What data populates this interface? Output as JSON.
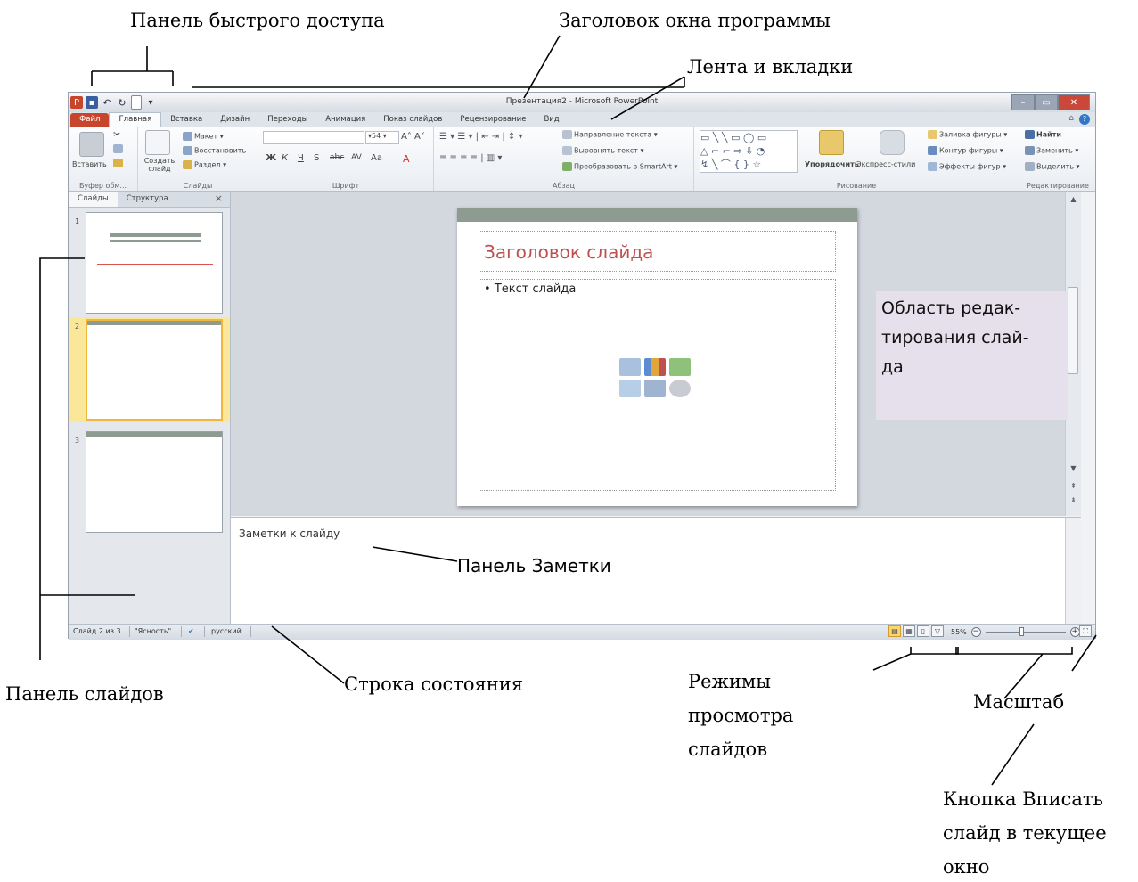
{
  "annotations": {
    "qat": "Панель быстрого доступа",
    "title": "Заголовок окна программы",
    "ribbon": "Лента и вкладки",
    "edit_area": "Область редак-\nтирования слай-\nда",
    "notes_pane": "Панель Заметки",
    "slides_pane": "Панель слайдов",
    "status_bar": "Строка состояния",
    "view_modes": [
      "Режимы",
      "просмотра",
      "слайдов"
    ],
    "zoom": "Масштаб",
    "fit_button": [
      "Кнопка Вписать",
      "слайд в текущее",
      "окно"
    ]
  },
  "window": {
    "title": "Презентация2 - Microsoft PowerPoint",
    "tabs": [
      "Файл",
      "Главная",
      "Вставка",
      "Дизайн",
      "Переходы",
      "Анимация",
      "Показ слайдов",
      "Рецензирование",
      "Вид"
    ],
    "active_tab": "Главная"
  },
  "ribbon": {
    "clipboard": {
      "paste": "Вставить",
      "label": "Буфер обм..."
    },
    "slides": {
      "new_slide": "Создать слайд",
      "layout": "Макет",
      "reset": "Восстановить",
      "section": "Раздел",
      "label": "Слайды"
    },
    "font": {
      "size": "54",
      "bold": "Ж",
      "italic": "К",
      "underline": "Ч",
      "strike": "S",
      "change_case": "Aa",
      "font_color": "A",
      "label": "Шрифт"
    },
    "paragraph": {
      "direction": "Направление текста",
      "align": "Выровнять текст",
      "smartart": "Преобразовать в SmartArt",
      "label": "Абзац"
    },
    "drawing": {
      "arrange": "Упорядочить",
      "quick_styles": "Экспресс-стили",
      "fill": "Заливка фигуры",
      "outline": "Контур фигуры",
      "effects": "Эффекты фигур",
      "label": "Рисование"
    },
    "editing": {
      "find": "Найти",
      "replace": "Заменить",
      "select": "Выделить",
      "label": "Редактирование"
    }
  },
  "left_pane": {
    "tab_slides": "Слайды",
    "tab_outline": "Структура",
    "close": "×",
    "slides": [
      "1",
      "2",
      "3"
    ],
    "selected": 2
  },
  "slide": {
    "title": "Заголовок слайда",
    "body": "Текст слайда"
  },
  "notes": {
    "placeholder": "Заметки к слайду"
  },
  "statusbar": {
    "slide_info": "Слайд 2 из 3",
    "theme": "\"Ясность\"",
    "language": "русский",
    "zoom": "55%"
  },
  "colors": {
    "file_tab": "#c8452d",
    "slide_title": "#c0504d",
    "selected_thumb": "#fbe79a",
    "callout_bg": "#e6e0ec"
  }
}
